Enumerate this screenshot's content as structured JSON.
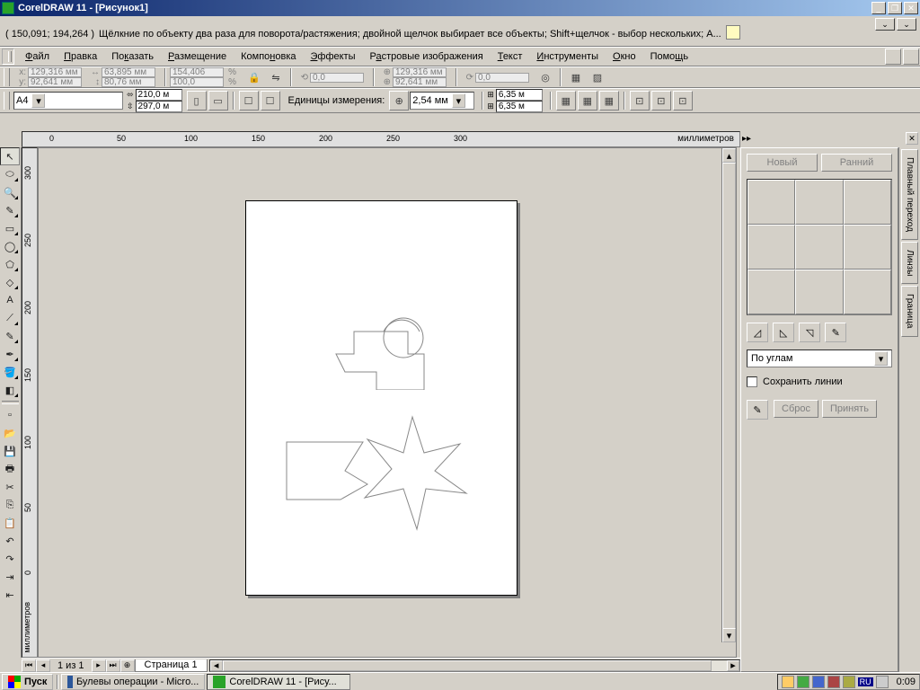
{
  "app": {
    "title": "CorelDRAW 11 - [Рисунок1]"
  },
  "hint": {
    "coord": "( 150,091; 194,264 )",
    "text": "Щёлкние по объекту два раза для поворота/растяжения; двойной щелчок выбирает все объекты; Shift+щелчок - выбор нескольких; A..."
  },
  "menus": [
    "Файл",
    "Правка",
    "Показать",
    "Размещение",
    "Компоновка",
    "Эффекты",
    "Растровые изображения",
    "Текст",
    "Инструменты",
    "Окно",
    "Помощь"
  ],
  "prop1": {
    "x": "129,316 мм",
    "y": "92,641 мм",
    "w": "63,895 мм",
    "h": "80,76 мм",
    "sx": "154,406",
    "sy": "100,0",
    "rot": "0,0",
    "cx": "129,316 мм",
    "cy": "92,641 мм",
    "r2": "0,0"
  },
  "prop2": {
    "paper": "A4",
    "pw": "210,0 м",
    "ph": "297,0 м",
    "units_label": "Единицы измерения:",
    "unit_val": "2,54 мм",
    "nx": "6,35 м",
    "ny": "6,35 м"
  },
  "rulerH": {
    "ticks": [
      "0",
      "50",
      "100",
      "150",
      "200",
      "250",
      "300"
    ],
    "label": "миллиметров"
  },
  "rulerV": {
    "ticks": [
      "300",
      "250",
      "200",
      "150",
      "100",
      "50",
      "0"
    ],
    "label": "миллиметров"
  },
  "docker": {
    "new_btn": "Новый",
    "prev_btn": "Ранний",
    "mode": "По углам",
    "keep_lines": "Сохранить линии",
    "reset": "Сброс",
    "apply": "Принять",
    "tab1": "Плавный переход",
    "tab2": "Линзы",
    "tab3": "Граница"
  },
  "page": {
    "count_text": "1 из 1",
    "tab": "Страница 1"
  },
  "taskbar": {
    "start": "Пуск",
    "task1": "Булевы операции - Micro...",
    "task2": "CorelDRAW 11 - [Рису...",
    "lang": "RU",
    "clock": "0:09"
  }
}
